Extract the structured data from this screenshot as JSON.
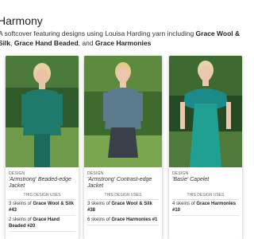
{
  "page": {
    "title": "Harmony",
    "desc_prefix": "A softcover featuring designs using Louisa Harding yarn including ",
    "yarn1": "Grace Wool & Silk",
    "sep1": ", ",
    "yarn2": "Grace Hand Beaded",
    "sep2": ", and ",
    "yarn3": "Grace Harmonies"
  },
  "cards": [
    {
      "label": "DESIGN",
      "name": "'Armstrong' Beaded-edge Jacket",
      "uses_label": "THIS DESIGN USES",
      "yarns": [
        {
          "qty": "3 skeins of ",
          "name": "Grace Wool & Silk #43"
        },
        {
          "qty": "2 skeins of ",
          "name": "Grace Hand Beaded #20"
        }
      ],
      "colors": {
        "bg": "#2f5a2a",
        "garment": "#1e7a6a",
        "skin": "#e9c2a8",
        "hair": "#e6d2a0"
      }
    },
    {
      "label": "DESIGN",
      "name": "'Armstrong' Contrast-edge Jacket",
      "uses_label": "THIS DESIGN USES",
      "yarns": [
        {
          "qty": "3 skeins of ",
          "name": "Grace Wool & Silk #38"
        },
        {
          "qty": "6 skeins of ",
          "name": "Grace Harmonies #1"
        }
      ],
      "colors": {
        "bg": "#3f6a2e",
        "garment": "#5a7a8e",
        "skin": "#ecc6ad",
        "hair": "#e2cc90"
      }
    },
    {
      "label": "DESIGN",
      "name": "'Basie' Capelet",
      "uses_label": "THIS DESIGN USES",
      "yarns": [
        {
          "qty": "4 skeins of ",
          "name": "Grace Harmonies #10"
        }
      ],
      "colors": {
        "bg": "#264a24",
        "garment": "#1b8a8a",
        "skin": "#ecc7b0",
        "hair": "#e8d5a5"
      }
    }
  ]
}
